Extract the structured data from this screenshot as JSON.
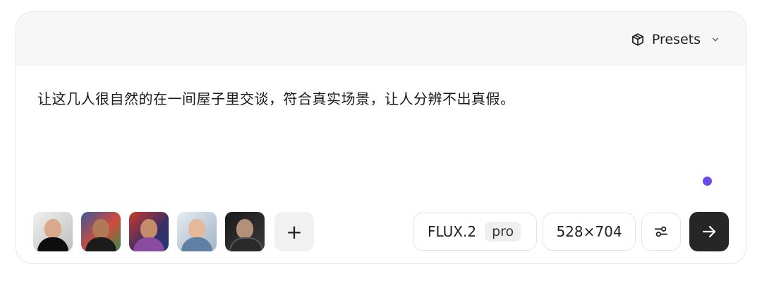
{
  "header": {
    "presets_label": "Presets",
    "presets_icon": "cube-icon",
    "dropdown_icon": "chevron-down-icon"
  },
  "prompt": {
    "text": "让这几人很自然的在一间屋子里交谈，符合真实场景，让人分辨不出真假。"
  },
  "status": {
    "dot_color": "#6a4ce6"
  },
  "reference_images": [
    {
      "name": "reference-image-1"
    },
    {
      "name": "reference-image-2"
    },
    {
      "name": "reference-image-3"
    },
    {
      "name": "reference-image-4"
    },
    {
      "name": "reference-image-5"
    }
  ],
  "add_button": {
    "label": "+"
  },
  "model": {
    "name": "FLUX.2",
    "variant": "pro"
  },
  "size": {
    "label": "528×704"
  },
  "settings": {
    "icon": "sliders-icon"
  },
  "send": {
    "icon": "arrow-right-icon"
  }
}
